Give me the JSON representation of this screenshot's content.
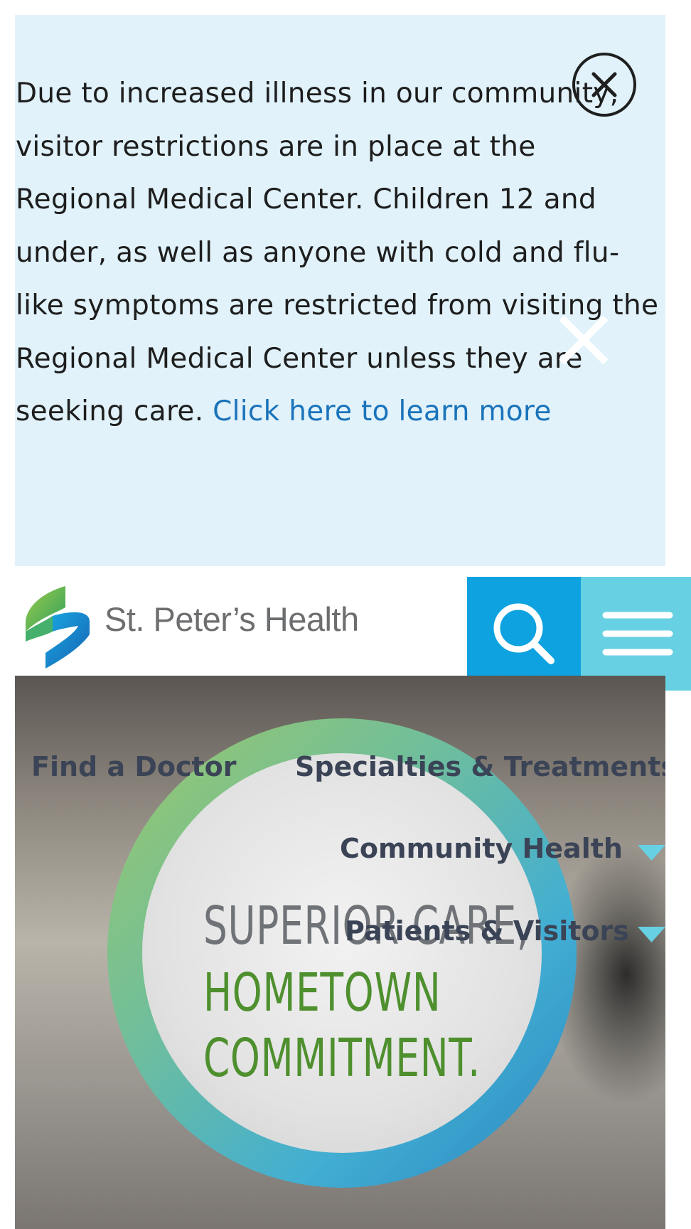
{
  "alert": {
    "text": "Due to increased illness in our community, visitor restrictions are in place at the Regional Medical Center. Children 12 and under, as well as anyone with cold and flu-like symptoms are restricted from visiting the Regional Medical Center unless they are seeking care.",
    "link_text": "Click here to learn more",
    "close_icon": "close-circle-icon",
    "background_color": "#e1f2fa",
    "link_color": "#1a73ba"
  },
  "header": {
    "brand_name": "St. Peter’s Health",
    "logo_icon": "ribbon-s-logo",
    "search_icon": "search-icon",
    "menu_icon": "hamburger-menu-icon",
    "search_color": "#0ea2e0",
    "menu_color": "#67d1e3"
  },
  "hero": {
    "line1": "SUPERIOR CARE,",
    "line2": "HOMETOWN",
    "line3": "COMMITMENT."
  },
  "nav": {
    "items": [
      {
        "label": "Find a Doctor"
      },
      {
        "label": "Specialties & Treatments"
      },
      {
        "label": "Community Health",
        "caret_icon": "caret-down-icon"
      },
      {
        "label": "Patients & Visitors",
        "caret_icon": "caret-down-icon"
      }
    ],
    "text_color": "#3b4456",
    "caret_color": "#67d1e3"
  }
}
